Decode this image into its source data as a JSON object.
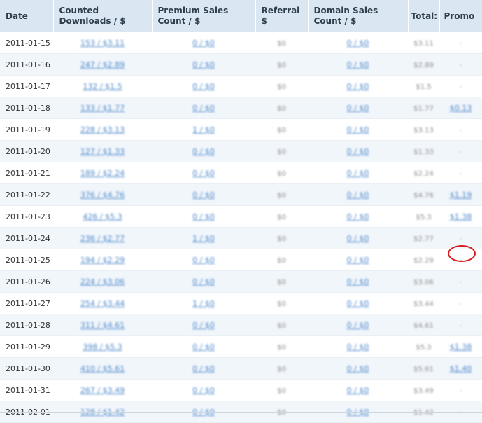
{
  "headers": {
    "date": "Date",
    "counted_downloads": "Counted Downloads / $",
    "premium_sales": "Premium Sales Count / $",
    "referral": "Referral $",
    "domain_sales": "Domain Sales Count / $",
    "total": "Total:",
    "promo": "Promo"
  },
  "rows": [
    {
      "date": "2011-01-15",
      "downloads": "153 / $3.11",
      "premium": "0 / $0",
      "referral": "$0",
      "domain": "0 / $0",
      "total": "$3.11",
      "promo": "-"
    },
    {
      "date": "2011-01-16",
      "downloads": "247 / $2.89",
      "premium": "0 / $0",
      "referral": "$0",
      "domain": "0 / $0",
      "total": "$2.89",
      "promo": "-"
    },
    {
      "date": "2011-01-17",
      "downloads": "132 / $1.5",
      "premium": "0 / $0",
      "referral": "$0",
      "domain": "0 / $0",
      "total": "$1.5",
      "promo": "-"
    },
    {
      "date": "2011-01-18",
      "downloads": "133 / $1.77",
      "premium": "0 / $0",
      "referral": "$0",
      "domain": "0 / $0",
      "total": "$1.77",
      "promo": "$0.13"
    },
    {
      "date": "2011-01-19",
      "downloads": "228 / $3.13",
      "premium": "1 / $0",
      "referral": "$0",
      "domain": "0 / $0",
      "total": "$3.13",
      "promo": "-"
    },
    {
      "date": "2011-01-20",
      "downloads": "127 / $1.33",
      "premium": "0 / $0",
      "referral": "$0",
      "domain": "0 / $0",
      "total": "$1.33",
      "promo": "-"
    },
    {
      "date": "2011-01-21",
      "downloads": "189 / $2.24",
      "premium": "0 / $0",
      "referral": "$0",
      "domain": "0 / $0",
      "total": "$2.24",
      "promo": "-"
    },
    {
      "date": "2011-01-22",
      "downloads": "376 / $4.76",
      "premium": "0 / $0",
      "referral": "$0",
      "domain": "0 / $0",
      "total": "$4.76",
      "promo": "$1.19"
    },
    {
      "date": "2011-01-23",
      "downloads": "426 / $5.3",
      "premium": "0 / $0",
      "referral": "$0",
      "domain": "0 / $0",
      "total": "$5.3",
      "promo": "$1.38"
    },
    {
      "date": "2011-01-24",
      "downloads": "236 / $2.77",
      "premium": "1 / $0",
      "referral": "$0",
      "domain": "0 / $0",
      "total": "$2.77",
      "promo": "-"
    },
    {
      "date": "2011-01-25",
      "downloads": "194 / $2.29",
      "premium": "0 / $0",
      "referral": "$0",
      "domain": "0 / $0",
      "total": "$2.29",
      "promo": "-"
    },
    {
      "date": "2011-01-26",
      "downloads": "224 / $3.06",
      "premium": "0 / $0",
      "referral": "$0",
      "domain": "0 / $0",
      "total": "$3.06",
      "promo": "-"
    },
    {
      "date": "2011-01-27",
      "downloads": "254 / $3.44",
      "premium": "1 / $0",
      "referral": "$0",
      "domain": "0 / $0",
      "total": "$3.44",
      "promo": "-"
    },
    {
      "date": "2011-01-28",
      "downloads": "311 / $4.61",
      "premium": "0 / $0",
      "referral": "$0",
      "domain": "0 / $0",
      "total": "$4.61",
      "promo": "-"
    },
    {
      "date": "2011-01-29",
      "downloads": "398 / $5.3",
      "premium": "0 / $0",
      "referral": "$0",
      "domain": "0 / $0",
      "total": "$5.3",
      "promo": "$1.38"
    },
    {
      "date": "2011-01-30",
      "downloads": "410 / $5.61",
      "premium": "0 / $0",
      "referral": "$0",
      "domain": "0 / $0",
      "total": "$5.61",
      "promo": "$1.40"
    },
    {
      "date": "2011-01-31",
      "downloads": "267 / $3.49",
      "premium": "0 / $0",
      "referral": "$0",
      "domain": "0 / $0",
      "total": "$3.49",
      "promo": "-"
    },
    {
      "date": "2011-02-01",
      "downloads": "128 / $1.42",
      "premium": "0 / $0",
      "referral": "$0",
      "domain": "0 / $0",
      "total": "$1.42",
      "promo": "-"
    }
  ],
  "colors": {
    "header_bg": "#dae7f3",
    "row_alt_bg": "#f1f6fb",
    "link": "#4a86c9",
    "highlight_circle": "#d81b1b"
  }
}
